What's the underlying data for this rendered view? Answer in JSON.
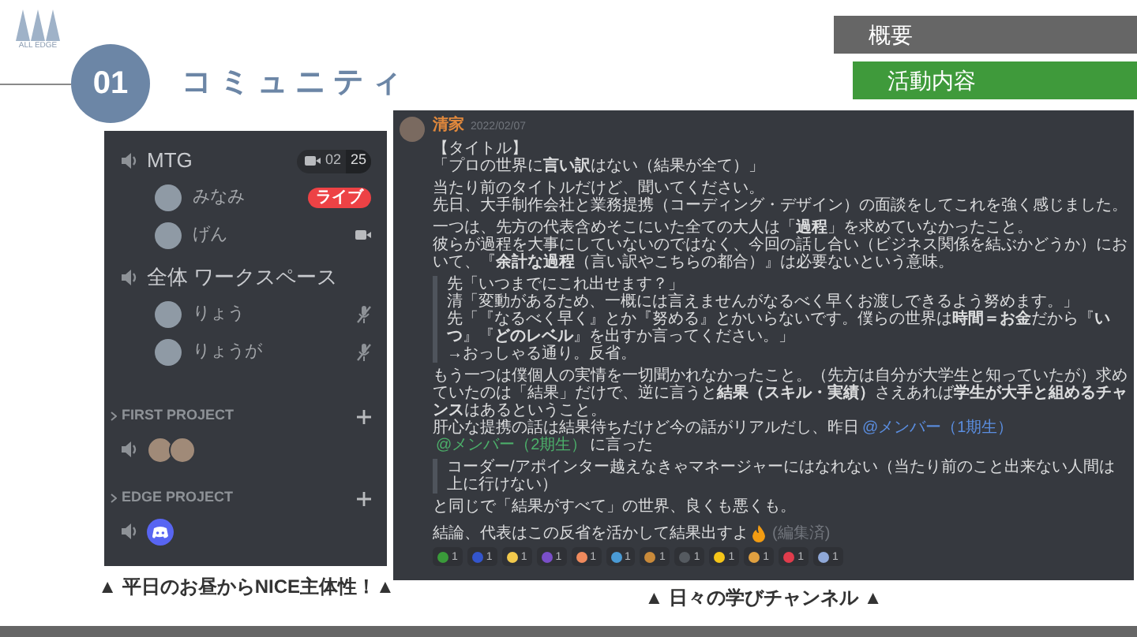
{
  "logo": {
    "text": "ALL EDGE"
  },
  "nav": [
    {
      "label": "概要",
      "selected": false
    },
    {
      "label": "活動内容",
      "selected": true
    }
  ],
  "section": {
    "number": "01",
    "title": "コミュニティ"
  },
  "voice_panel": {
    "channels": [
      {
        "name": "MTG",
        "video_count": "02",
        "limit": "25",
        "members": [
          {
            "name": "みなみ",
            "kind": "live",
            "badge": "ライブ"
          },
          {
            "name": "げん",
            "kind": "video"
          }
        ]
      },
      {
        "name": "全体 ワークスペース",
        "members": [
          {
            "name": "りょう",
            "kind": "muted"
          },
          {
            "name": "りょうが",
            "kind": "muted"
          }
        ]
      }
    ],
    "categories": [
      {
        "name": "FIRST PROJECT",
        "participants": [
          {
            "kind": "photo"
          },
          {
            "kind": "photo"
          }
        ]
      },
      {
        "name": "EDGE PROJECT",
        "participants": [
          {
            "kind": "discord"
          }
        ]
      }
    ]
  },
  "left_caption": "▲ 平日のお昼からNICE主体性！▲",
  "chat": {
    "author": "清家",
    "date": "2022/02/07",
    "blocks": [
      {
        "kind": "paragraph",
        "lines": [
          "【タイトル】",
          "「プロの世界に**言い訳**はない（結果が全て）」"
        ]
      },
      {
        "kind": "paragraph",
        "lines": [
          "当たり前のタイトルだけど、聞いてください。",
          "先日、大手制作会社と業務提携（コーディング・デザイン）の面談をしてこれを強く感じました。"
        ]
      },
      {
        "kind": "paragraph",
        "lines": [
          "一つは、先方の代表含めそこにいた全ての大人は「**過程**」を求めていなかったこと。",
          "彼らが過程を大事にしていないのではなく、今回の話し合い（ビジネス関係を結ぶかどうか）において、『**余計な過程**（言い訳やこちらの都合）』は必要ないという意味。"
        ]
      },
      {
        "kind": "quote",
        "lines": [
          "先「いつまでにこれ出せます？」",
          "清「変動があるため、一概には言えませんがなるべく早くお渡しできるよう努めます。」",
          "先「『なるべく早く』とか『努める』とかいらないです。僕らの世界は**時間＝お金**だから『**いつ**』『**どのレベル**』を出すか言ってください。」",
          "→おっしゃる通り。反省。"
        ]
      },
      {
        "kind": "paragraph",
        "lines": [
          "もう一つは僕個人の実情を一切聞かれなかったこと。（先方は自分が大学生と知っていたが）求めていたのは「結果」だけで、逆に言うと**結果（スキル・実績）**さえあれば**学生が大手と組めるチャンス**はあるということ。"
        ]
      },
      {
        "kind": "mentions",
        "parts": [
          {
            "kind": "text",
            "text": "肝心な提携の話は結果待ちだけど今の話がリアルだし、昨日"
          },
          {
            "kind": "mention",
            "text": "@メンバー（1期生）",
            "color": "#5b8ee0"
          },
          {
            "kind": "mention",
            "text": "@メンバー（2期生）",
            "color": "#4caf6a"
          },
          {
            "kind": "text",
            "text": "に言った"
          }
        ]
      },
      {
        "kind": "quote",
        "lines": [
          "コーダー/アポインター越えなきゃマネージャーにはなれない（当たり前のこと出来ない人間は上に行けない）"
        ]
      },
      {
        "kind": "paragraph",
        "lines": [
          "と同じで「結果がすべて」の世界、良くも悪くも。"
        ]
      },
      {
        "kind": "conclusion",
        "text": "結論、代表はこの反省を活かして結果出すよ",
        "edited": "(編集済)"
      }
    ],
    "reactions": [
      {
        "color": "#3a9a3a",
        "count": "1"
      },
      {
        "color": "#3355cc",
        "count": "1"
      },
      {
        "color": "#f2c94c",
        "count": "1"
      },
      {
        "color": "#7a4fc9",
        "count": "1"
      },
      {
        "color": "#f08a5d",
        "count": "1"
      },
      {
        "color": "#4a9bd6",
        "count": "1"
      },
      {
        "color": "#c98a3a",
        "count": "1"
      },
      {
        "color": "#555a60",
        "count": "1"
      },
      {
        "color": "#f5c518",
        "count": "1"
      },
      {
        "color": "#e0a040",
        "count": "1"
      },
      {
        "color": "#e03c4c",
        "count": "1"
      },
      {
        "color": "#8fa8d8",
        "count": "1"
      }
    ]
  },
  "right_caption": "▲ 日々の学びチャンネル ▲"
}
